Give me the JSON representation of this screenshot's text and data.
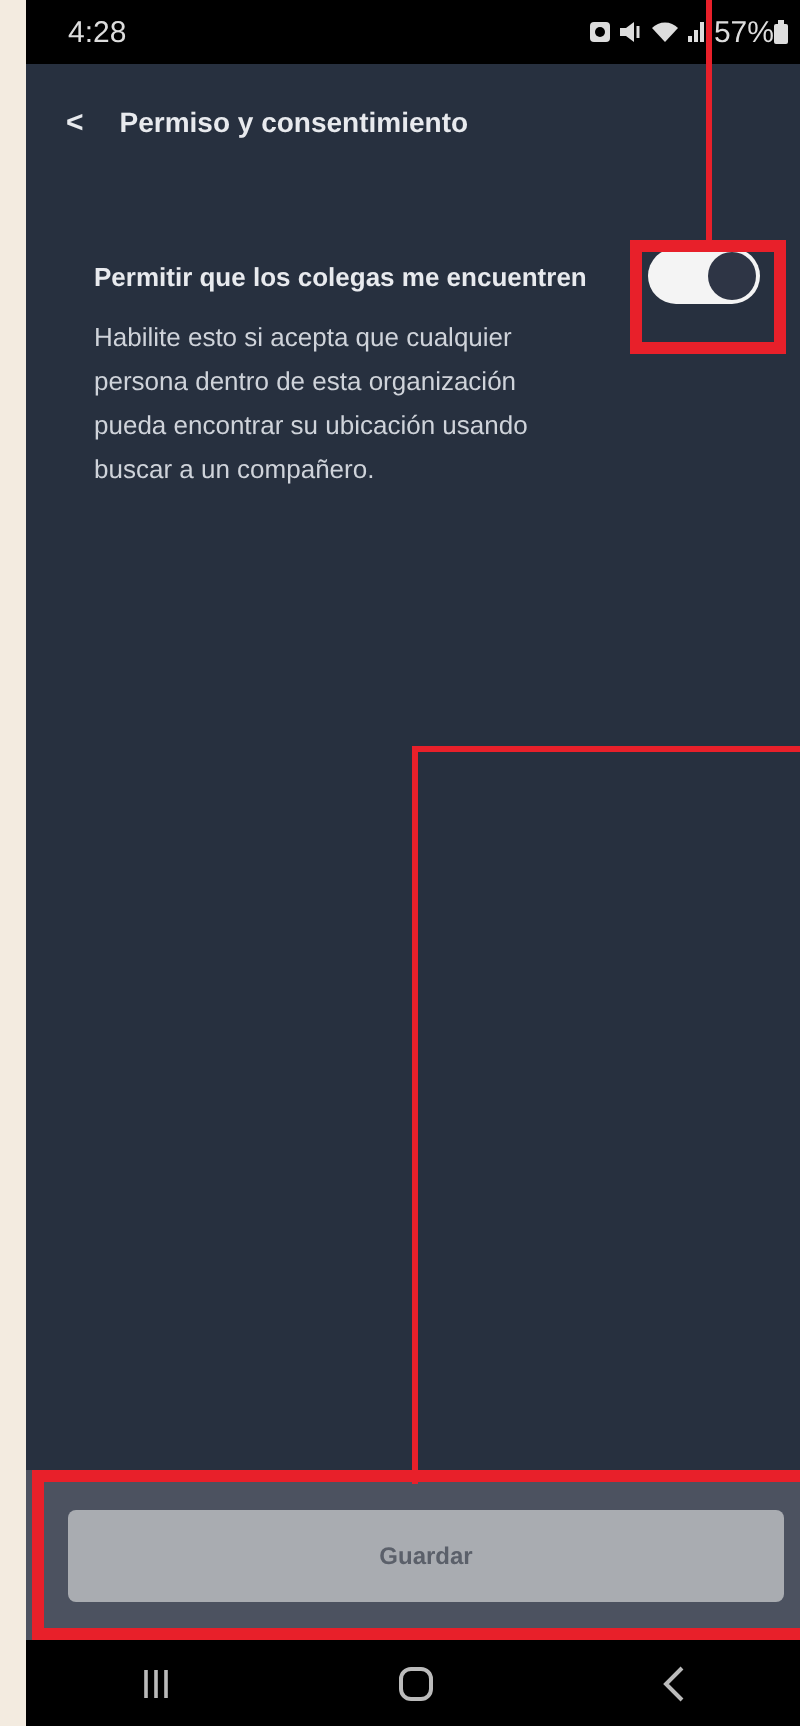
{
  "status_bar": {
    "time": "4:28",
    "battery": "57%"
  },
  "header": {
    "back": "<",
    "title": "Permiso y consentimiento"
  },
  "setting": {
    "label": "Permitir que los colegas me encuentren",
    "on": true,
    "description": "Habilite esto si acepta que cualquier persona dentro de esta organización pueda encontrar su ubicación usando buscar a un compañero."
  },
  "save_button": {
    "label": "Guardar",
    "disabled": true
  }
}
